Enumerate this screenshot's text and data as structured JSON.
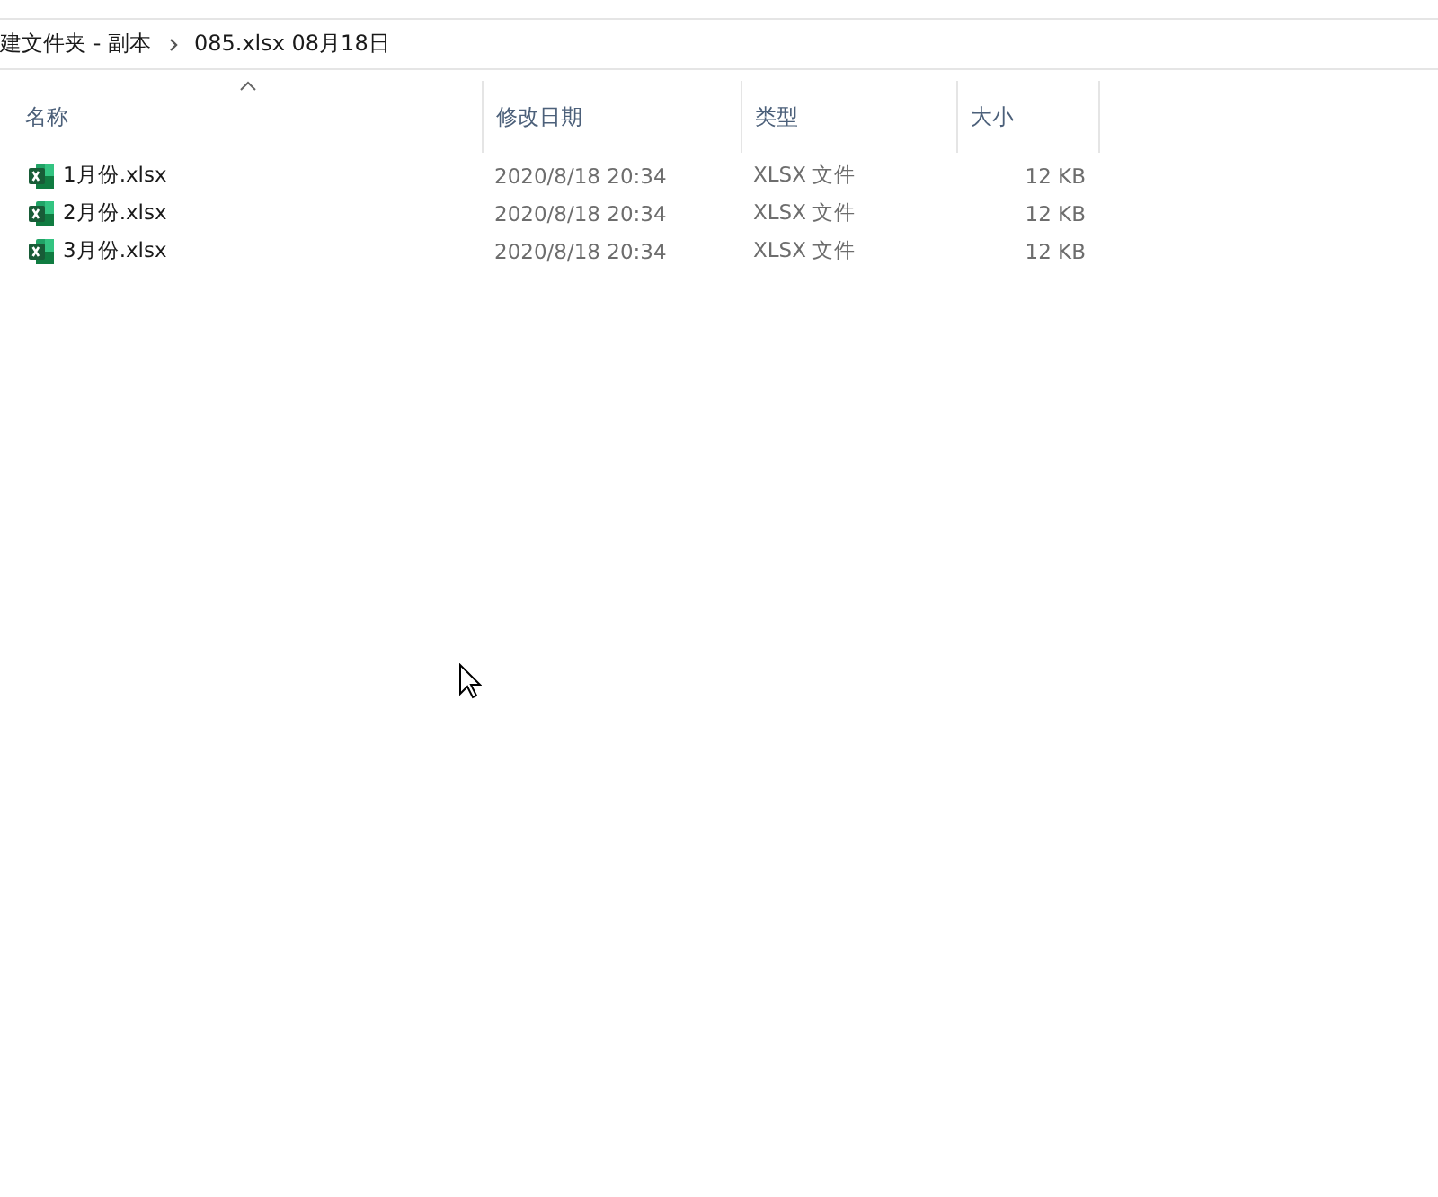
{
  "breadcrumb": [
    "建文件夹 - 副本",
    "085.xlsx 08月18日"
  ],
  "columns": [
    {
      "label": "名称",
      "sorted": true
    },
    {
      "label": "修改日期",
      "sorted": false
    },
    {
      "label": "类型",
      "sorted": false
    },
    {
      "label": "大小",
      "sorted": false
    }
  ],
  "files": [
    {
      "name": "1月份.xlsx",
      "modified": "2020/8/18 20:34",
      "type": "XLSX 文件",
      "size": "12 KB"
    },
    {
      "name": "2月份.xlsx",
      "modified": "2020/8/18 20:34",
      "type": "XLSX 文件",
      "size": "12 KB"
    },
    {
      "name": "3月份.xlsx",
      "modified": "2020/8/18 20:34",
      "type": "XLSX 文件",
      "size": "12 KB"
    }
  ]
}
